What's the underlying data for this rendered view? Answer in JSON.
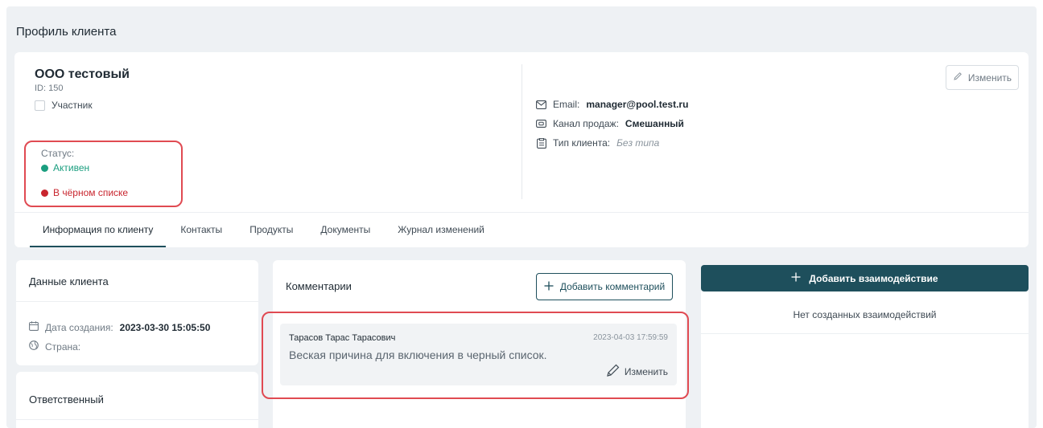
{
  "page": {
    "title": "Профиль клиента"
  },
  "profile": {
    "name": "ООО тестовый",
    "id_text": "ID: 150",
    "participant_label": "Участник",
    "status_label": "Статус:",
    "statuses": [
      {
        "label": "Активен",
        "color": "#1a9e7f"
      },
      {
        "label": "В чёрном списке",
        "color": "#c8252e"
      }
    ],
    "email_label": "Email:",
    "email_value": "manager@pool.test.ru",
    "channel_label": "Канал продаж:",
    "channel_value": "Смешанный",
    "type_label": "Тип клиента:",
    "type_value": "Без типа",
    "edit_label": "Изменить"
  },
  "tabs": [
    {
      "label": "Информация по клиенту",
      "active": true
    },
    {
      "label": "Контакты"
    },
    {
      "label": "Продукты"
    },
    {
      "label": "Документы"
    },
    {
      "label": "Журнал изменений"
    }
  ],
  "client_data": {
    "title": "Данные клиента",
    "created_label": "Дата создания:",
    "created_value": "2023-03-30 15:05:50",
    "country_label": "Страна:"
  },
  "responsible": {
    "title": "Ответственный"
  },
  "comments": {
    "title": "Комментарии",
    "add_label": "Добавить комментарий",
    "items": [
      {
        "author": "Тарасов Тарас Тарасович",
        "date": "2023-04-03 17:59:59",
        "text": "Веская причина для включения в черный список.",
        "edit_label": "Изменить"
      }
    ]
  },
  "interactions": {
    "add_label": "Добавить взаимодействие",
    "empty_text": "Нет созданных взаимодействий"
  },
  "colors": {
    "accent": "#1e4f5c",
    "highlight": "#e04a52"
  }
}
